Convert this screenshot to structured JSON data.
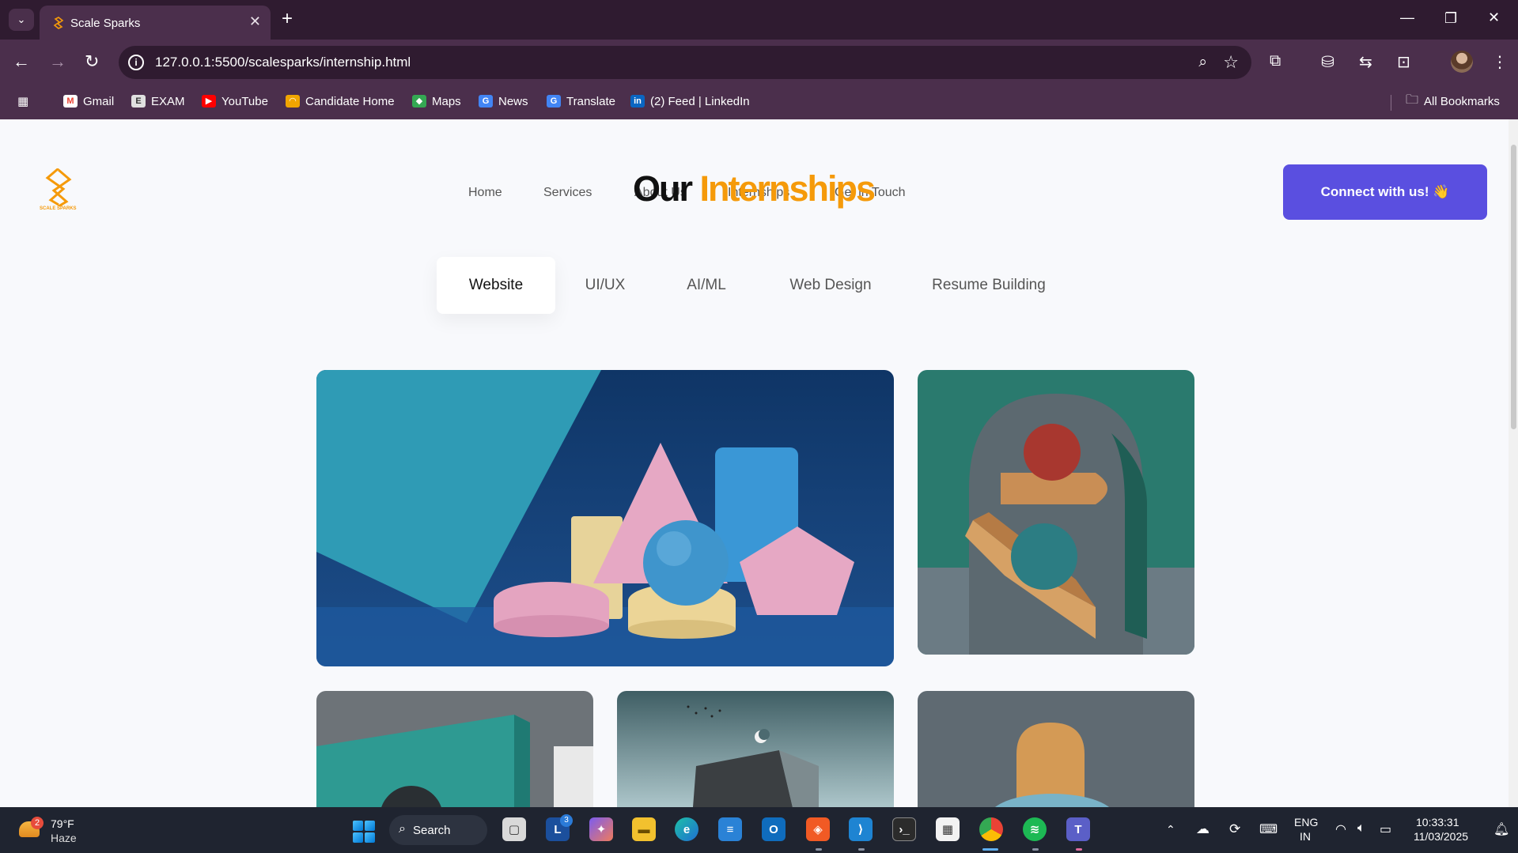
{
  "browser": {
    "tab_title": "Scale Sparks",
    "url": "127.0.0.1:5500/scalesparks/internship.html",
    "bookmarks": [
      {
        "label": "Gmail",
        "icon": "gmail-icon",
        "color": "#ea4335"
      },
      {
        "label": "EXAM",
        "icon": "exam-icon",
        "color": "#e0e0e0"
      },
      {
        "label": "YouTube",
        "icon": "youtube-icon",
        "color": "#ff0000"
      },
      {
        "label": "Candidate Home",
        "icon": "candidate-icon",
        "color": "#f0a500"
      },
      {
        "label": "Maps",
        "icon": "maps-icon",
        "color": "#34a853"
      },
      {
        "label": "News",
        "icon": "news-icon",
        "color": "#4285f4"
      },
      {
        "label": "Translate",
        "icon": "translate-icon",
        "color": "#4285f4"
      },
      {
        "label": "(2) Feed | LinkedIn",
        "icon": "linkedin-icon",
        "color": "#0a66c2"
      }
    ],
    "all_bookmarks": "All Bookmarks"
  },
  "site": {
    "logo_text": "SCALE SPARKS",
    "nav": {
      "home": "Home",
      "services": "Services",
      "about": "About Us",
      "internships": "Internships",
      "contact": "Get in Touch"
    },
    "heading_part1": "Our",
    "heading_part2": "Internships",
    "cta": "Connect with us! 👋",
    "tabs": [
      "Website",
      "UI/UX",
      "AI/ML",
      "Web Design",
      "Resume Building"
    ],
    "active_tab": "Website",
    "accent": "#f59a0a",
    "cta_color": "#5a4fe0"
  },
  "taskbar": {
    "weather_badge": "2",
    "temperature": "79°F",
    "condition": "Haze",
    "search_label": "Search",
    "lang_line1": "ENG",
    "lang_line2": "IN",
    "time": "10:33:31",
    "date": "11/03/2025",
    "lichess_badge": "3"
  }
}
